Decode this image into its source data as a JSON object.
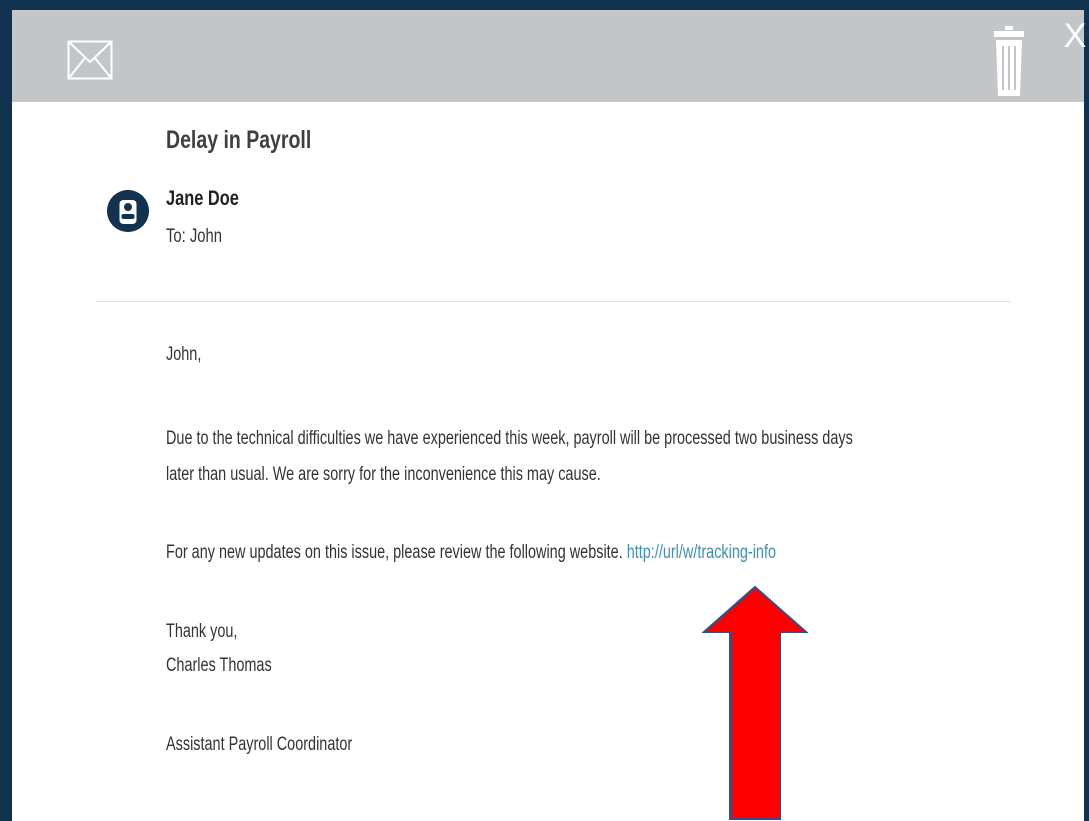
{
  "email": {
    "subject": "Delay in Payroll",
    "sender": "Jane Doe",
    "recipient": "To: John",
    "greeting": "John,",
    "paragraph1_line1": "Due to the technical difficulties we have experienced this week, payroll will be processed two business days",
    "paragraph1_line2": "later than  usual. We are sorry for the inconvenience this may cause.",
    "paragraph2_text": "For any new updates on this issue, please review the following website. ",
    "link_text": "http://url/w/tracking-info",
    "closing": "Thank you,",
    "signature_name": "Charles Thomas",
    "signature_title": "Assistant Payroll Coordinator"
  },
  "toolbar": {
    "close_label": "X"
  },
  "icons": {
    "mail": "mail-icon",
    "trash": "trash-icon",
    "avatar": "user-avatar-icon",
    "annotation": "red-up-arrow"
  },
  "colors": {
    "frame": "#12334f",
    "toolbar_bg": "#c3c6c8",
    "link": "#3d90b4",
    "arrow_fill": "#ff0000",
    "arrow_stroke": "#2f4f8f"
  }
}
